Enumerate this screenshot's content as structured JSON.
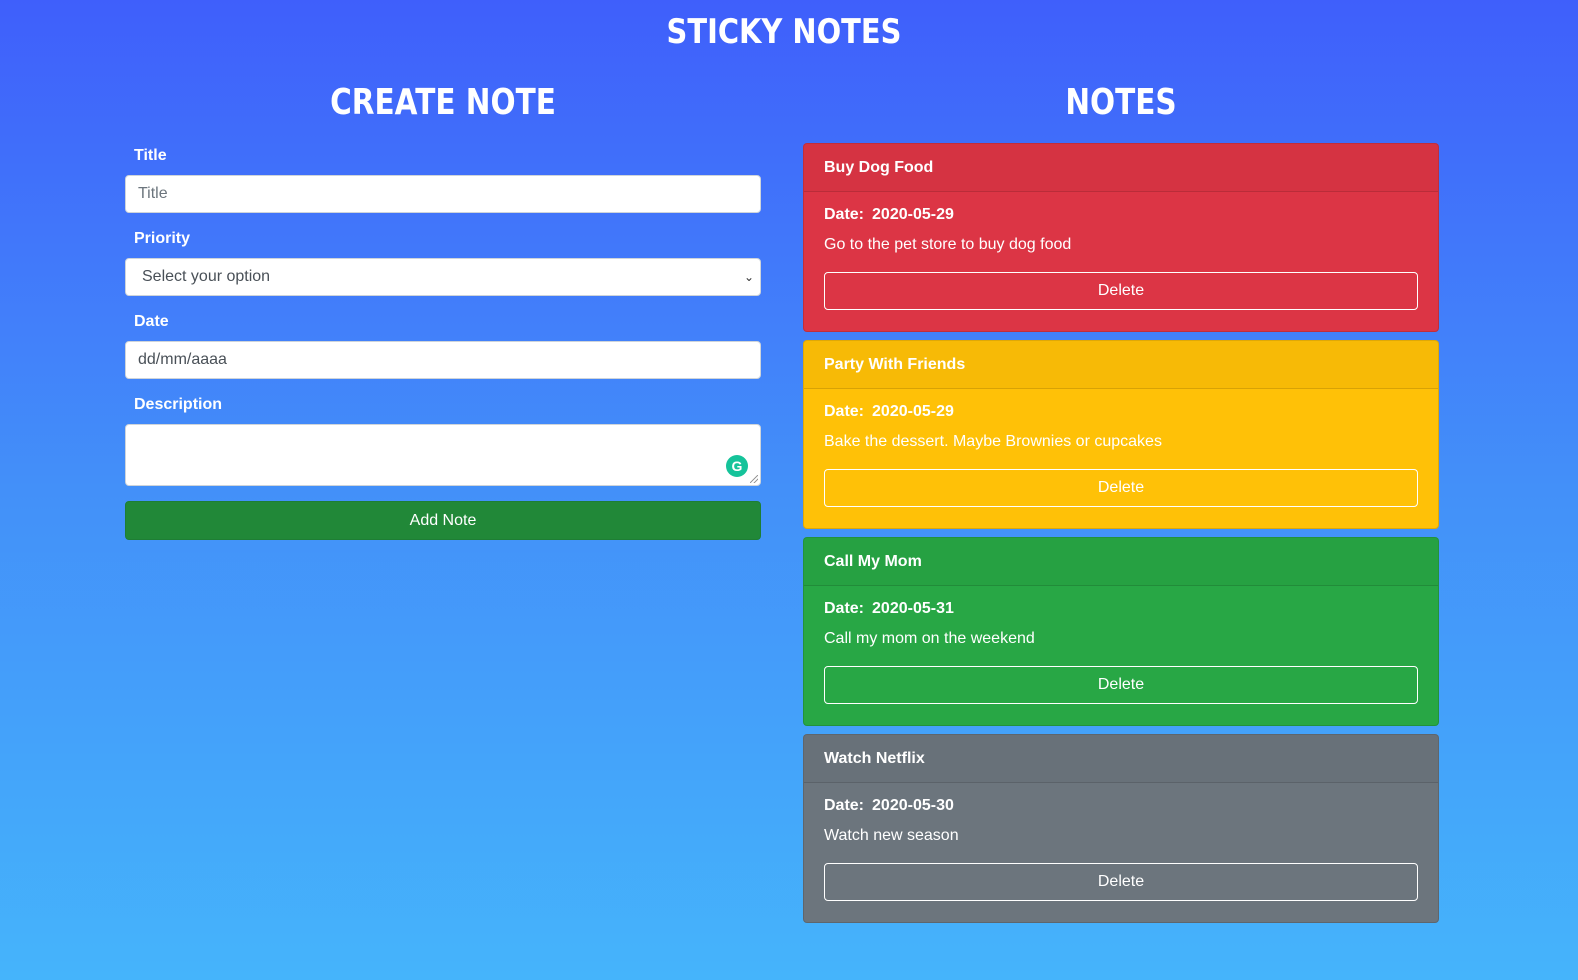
{
  "app": {
    "title": "STICKY NOTES"
  },
  "create": {
    "heading": "CREATE NOTE",
    "title_label": "Title",
    "title_placeholder": "Title",
    "priority_label": "Priority",
    "priority_selected": "Select your option",
    "date_label": "Date",
    "date_placeholder": "dd/mm/aaaa",
    "description_label": "Description",
    "add_button": "Add Note"
  },
  "notes_section": {
    "heading": "NOTES",
    "notes": [
      {
        "title": "Buy Dog Food",
        "date_label": "Date:",
        "date": "2020-05-29",
        "description": "Go to the pet store to buy dog food",
        "delete_label": "Delete",
        "color": "#dc3545"
      },
      {
        "title": "Party With Friends",
        "date_label": "Date:",
        "date": "2020-05-29",
        "description": "Bake the dessert. Maybe Brownies or cupcakes",
        "delete_label": "Delete",
        "color": "#ffc107"
      },
      {
        "title": "Call My Mom",
        "date_label": "Date:",
        "date": "2020-05-31",
        "description": "Call my mom on the weekend",
        "delete_label": "Delete",
        "color": "#28a745"
      },
      {
        "title": "Watch Netflix",
        "date_label": "Date:",
        "date": "2020-05-30",
        "description": "Watch new season",
        "delete_label": "Delete",
        "color": "#6c757d"
      }
    ]
  },
  "icons": {
    "grammarly": "grammarly-icon",
    "select_chevron": "chevron-down-icon"
  }
}
